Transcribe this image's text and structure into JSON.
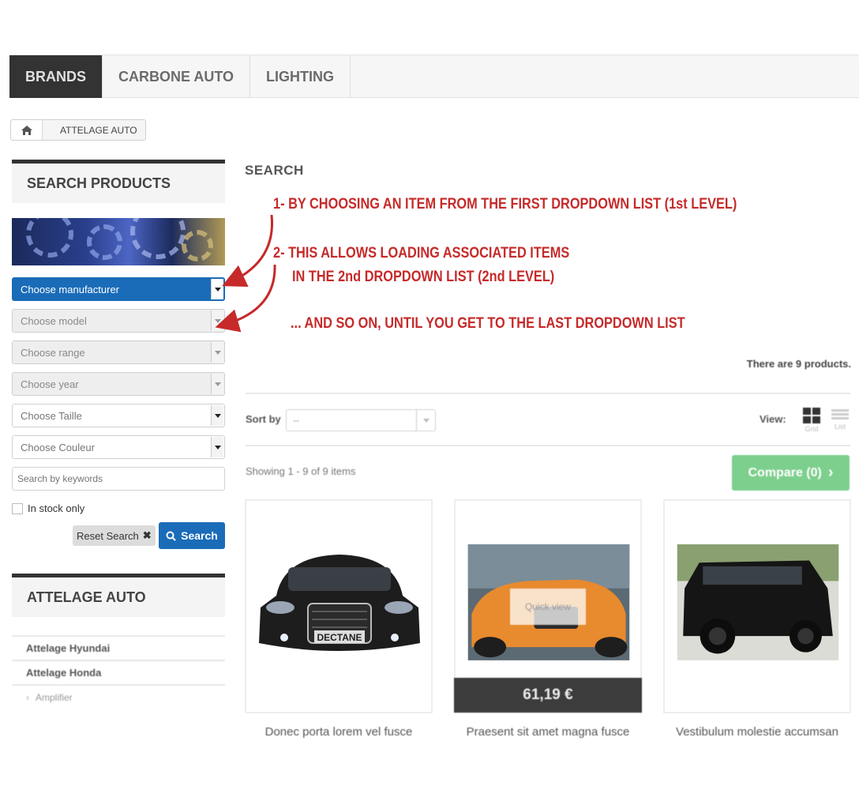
{
  "nav": {
    "tabs": [
      {
        "label": "BRANDS",
        "active": true
      },
      {
        "label": "CARBONE AUTO",
        "active": false
      },
      {
        "label": "LIGHTING",
        "active": false
      }
    ]
  },
  "breadcrumb": {
    "home_icon": "home-icon",
    "current": "ATTELAGE AUTO"
  },
  "sidebar": {
    "search_title": "SEARCH PRODUCTS",
    "selects": {
      "manufacturer": "Choose manufacturer",
      "model": "Choose model",
      "range": "Choose range",
      "year": "Choose year",
      "taille": "Choose Taille",
      "couleur": "Choose Couleur"
    },
    "keywords_placeholder": "Search by keywords",
    "stock_label": "In stock only",
    "reset_label": "Reset Search",
    "search_label": "Search",
    "category_title": "ATTELAGE AUTO",
    "categories": [
      {
        "label": "Attelage Hyundai"
      },
      {
        "label": "Attelage Honda"
      },
      {
        "label": "Amplifier"
      }
    ]
  },
  "main": {
    "title": "SEARCH",
    "product_count": "There are 9 products.",
    "sort_label": "Sort by",
    "sort_value": "--",
    "view_label": "View:",
    "view_grid": "Grid",
    "view_list": "List",
    "showing": "Showing 1 - 9 of 9 items",
    "compare": "Compare (0)",
    "quick_view": "Quick view",
    "products": [
      {
        "name": "Donec porta lorem vel fusce"
      },
      {
        "name": "Praesent sit amet magna fusce",
        "price": "61,19 €"
      },
      {
        "name": "Vestibulum molestie accumsan"
      }
    ]
  },
  "annotations": {
    "step1": "1- BY CHOOSING AN  ITEM  FROM THE FIRST DROPDOWN LIST (1st LEVEL)",
    "step2_line1": "2- THIS ALLOWS LOADING ASSOCIATED ITEMS",
    "step2_line2": "IN THE 2nd DROPDOWN LIST (2nd LEVEL)",
    "step3": "... AND SO ON, UNTIL YOU GET TO THE LAST DROPDOWN LIST"
  },
  "colors": {
    "primary": "#1a6cb8",
    "annotation": "#c62a2a",
    "compare": "#7dcf8e",
    "nav_active": "#333333"
  }
}
